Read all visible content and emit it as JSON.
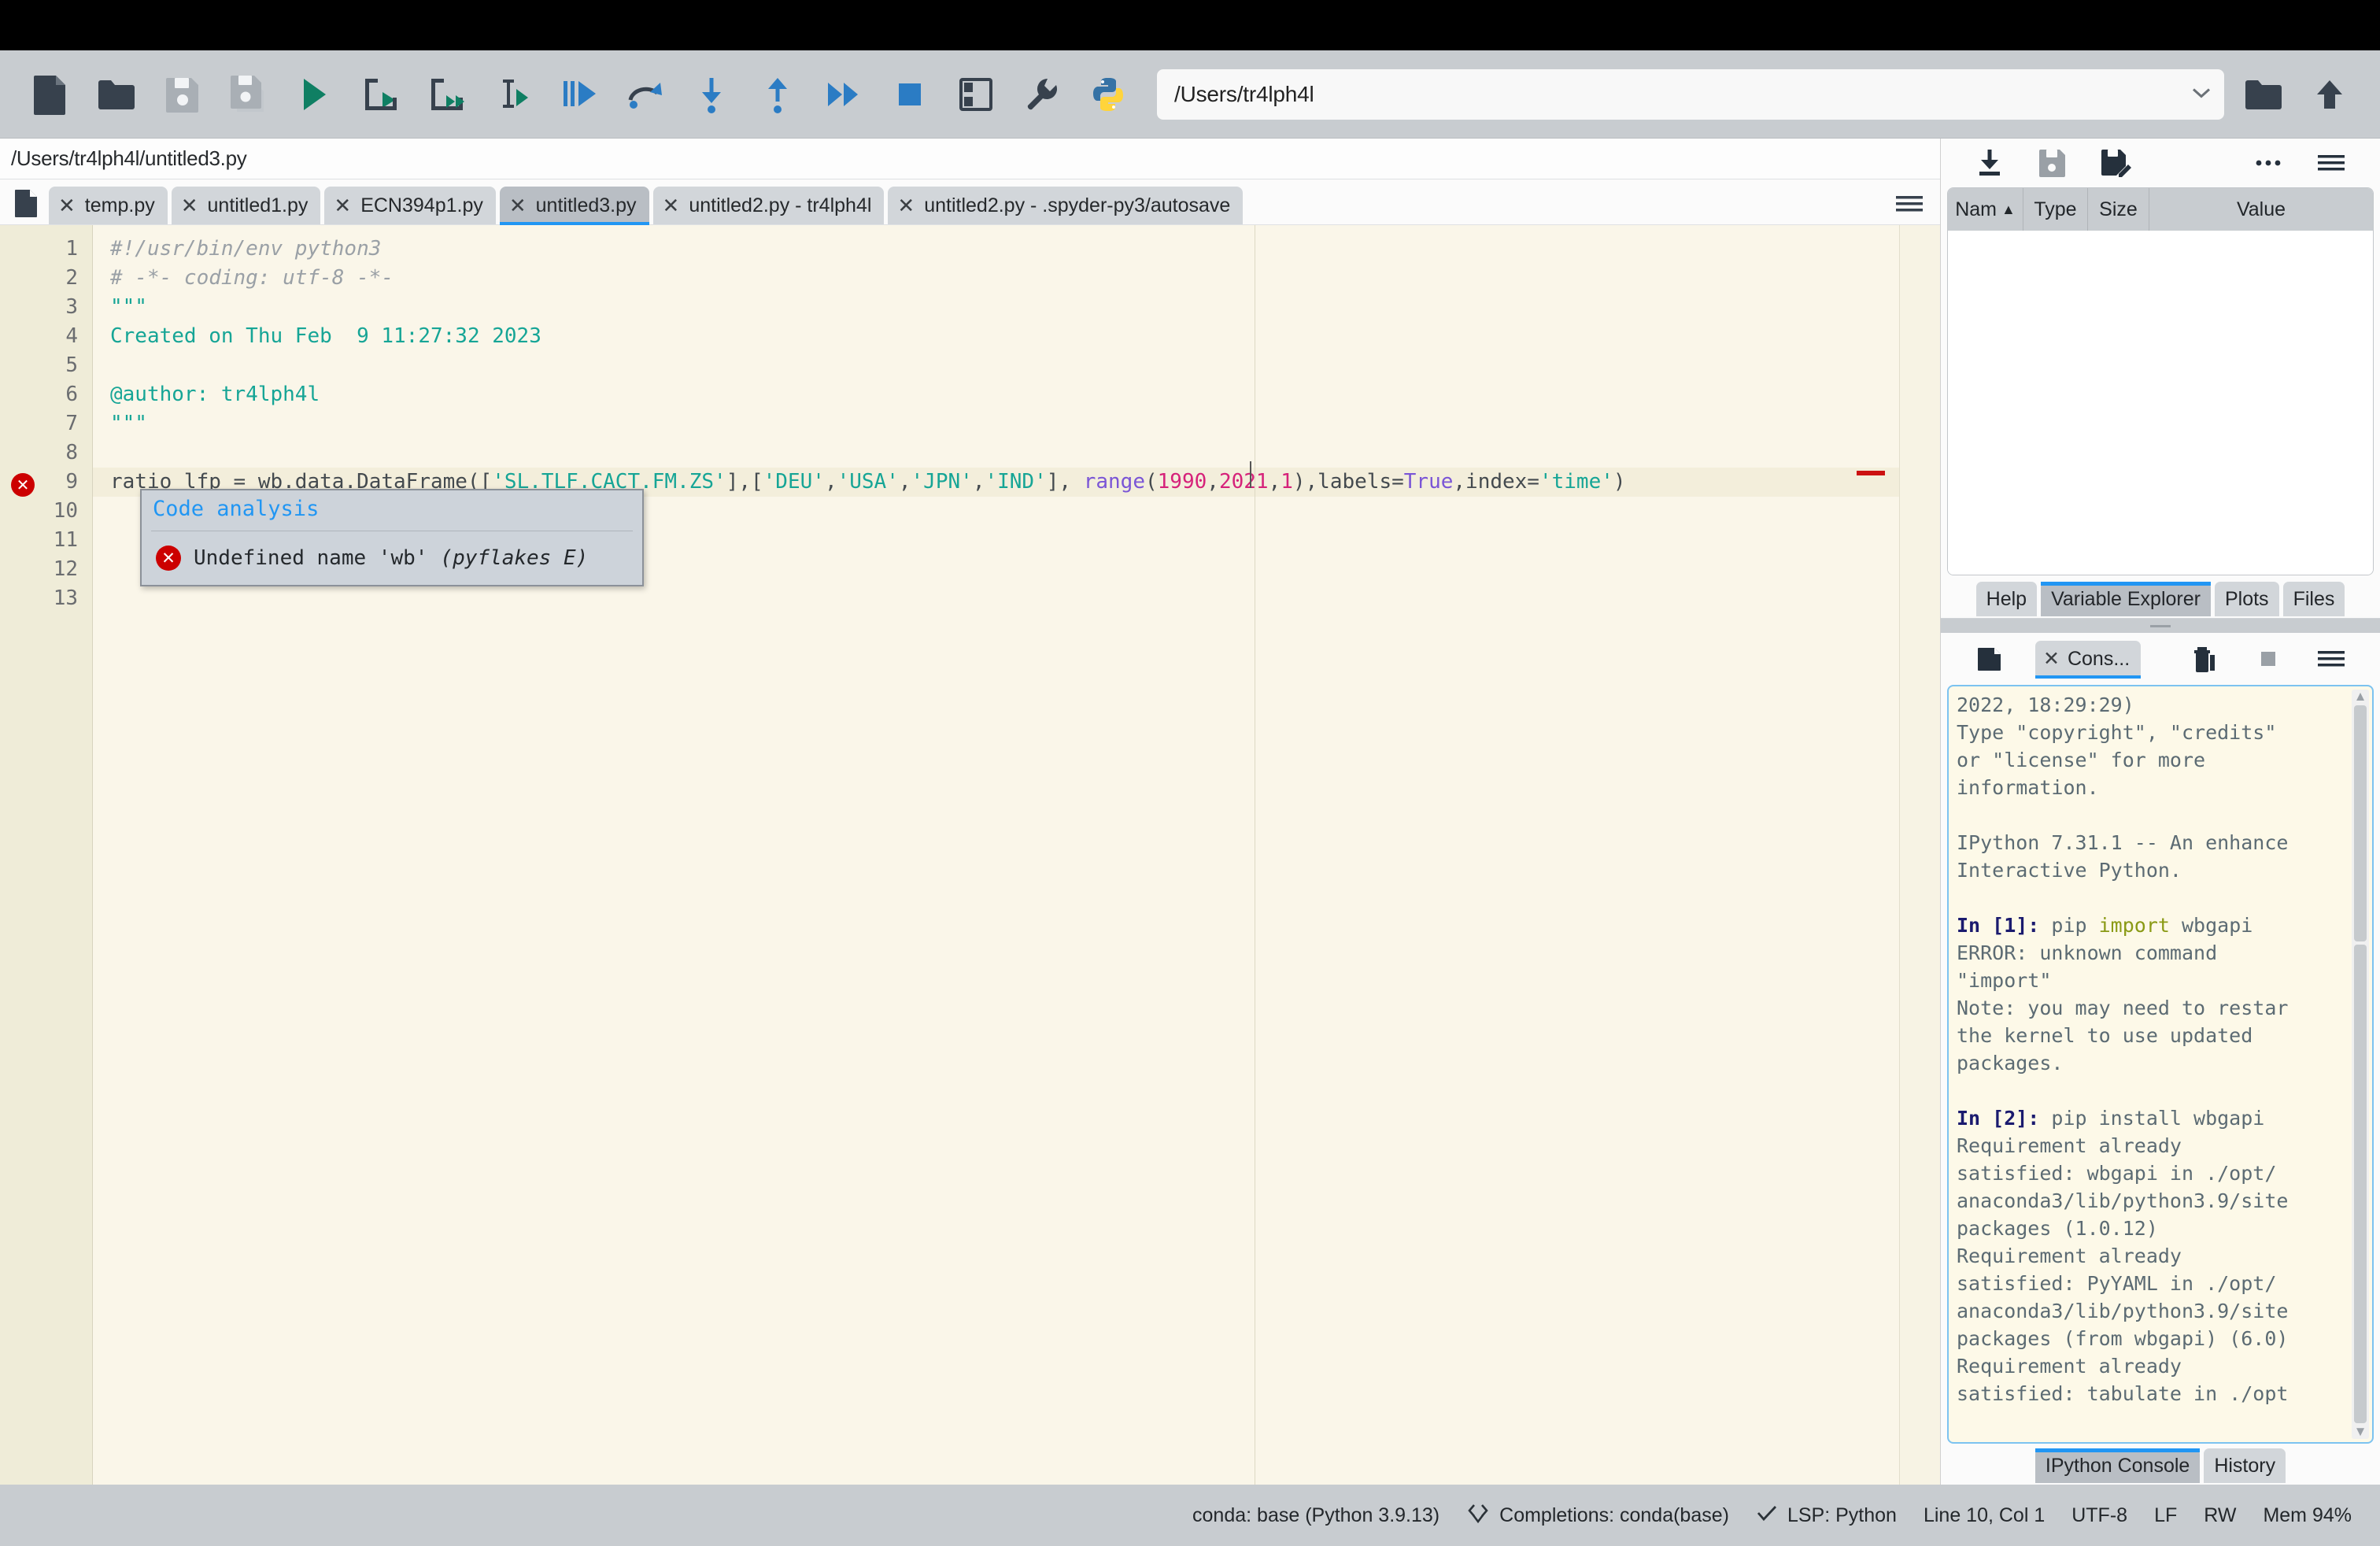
{
  "window": {
    "path_field_value": "/Users/tr4lph4l"
  },
  "toolbar": {
    "buttons": [
      {
        "name": "new-file-icon",
        "label": "New file"
      },
      {
        "name": "open-file-icon",
        "label": "Open file"
      },
      {
        "name": "save-file-icon",
        "label": "Save file"
      },
      {
        "name": "save-all-icon",
        "label": "Save all"
      },
      {
        "name": "run-file-icon",
        "label": "Run file"
      },
      {
        "name": "run-cell-icon",
        "label": "Run current cell"
      },
      {
        "name": "run-cell-advance-icon",
        "label": "Run cell and advance"
      },
      {
        "name": "run-selection-icon",
        "label": "Run selection"
      },
      {
        "name": "debug-file-icon",
        "label": "Debug file"
      },
      {
        "name": "step-over-icon",
        "label": "Step over"
      },
      {
        "name": "step-into-icon",
        "label": "Step into"
      },
      {
        "name": "step-return-icon",
        "label": "Step return"
      },
      {
        "name": "continue-icon",
        "label": "Continue"
      },
      {
        "name": "stop-debug-icon",
        "label": "Stop debugging"
      },
      {
        "name": "pane-layout-icon",
        "label": "Pane layout"
      },
      {
        "name": "preferences-icon",
        "label": "Preferences"
      },
      {
        "name": "python-path-icon",
        "label": "Python interpreter"
      }
    ],
    "browse_icon": "browse-folder-icon",
    "parent_icon": "parent-directory-icon"
  },
  "editor": {
    "breadcrumb": "/Users/tr4lph4l/untitled3.py",
    "tabs": [
      {
        "label": "temp.py",
        "active": false
      },
      {
        "label": "untitled1.py",
        "active": false
      },
      {
        "label": "ECN394p1.py",
        "active": false
      },
      {
        "label": "untitled3.py",
        "active": true
      },
      {
        "label": "untitled2.py - tr4lph4l",
        "active": false
      },
      {
        "label": "untitled2.py - .spyder-py3/autosave",
        "active": false
      }
    ],
    "line_numbers": [
      "1",
      "2",
      "3",
      "4",
      "5",
      "6",
      "7",
      "8",
      "9",
      "10",
      "11",
      "12",
      "13"
    ],
    "code_lines": [
      [
        {
          "t": "#!/usr/bin/env python3",
          "c": "cmt"
        }
      ],
      [
        {
          "t": "# -*- coding: utf-8 -*-",
          "c": "cmt"
        }
      ],
      [
        {
          "t": "\"\"\"",
          "c": "str"
        }
      ],
      [
        {
          "t": "Created on Thu Feb  9 11:27:32 2023",
          "c": "str"
        }
      ],
      [
        {
          "t": "",
          "c": "str"
        }
      ],
      [
        {
          "t": "@author: tr4lph4l",
          "c": "str"
        }
      ],
      [
        {
          "t": "\"\"\"",
          "c": "str"
        }
      ],
      [
        {
          "t": "",
          "c": "pln"
        }
      ],
      [
        {
          "t": "ratio_lfp = wb.data.DataFrame([",
          "c": "pln"
        },
        {
          "t": "'SL.TLF.CACT.FM.ZS'",
          "c": "str"
        },
        {
          "t": "],[",
          "c": "pln"
        },
        {
          "t": "'DEU'",
          "c": "str"
        },
        {
          "t": ",",
          "c": "pln"
        },
        {
          "t": "'USA'",
          "c": "str"
        },
        {
          "t": ",",
          "c": "pln"
        },
        {
          "t": "'JPN'",
          "c": "str"
        },
        {
          "t": ",",
          "c": "pln"
        },
        {
          "t": "'IND'",
          "c": "str"
        },
        {
          "t": "], ",
          "c": "pln"
        },
        {
          "t": "range",
          "c": "bld"
        },
        {
          "t": "(",
          "c": "pln"
        },
        {
          "t": "1990",
          "c": "num"
        },
        {
          "t": ",",
          "c": "pln"
        },
        {
          "t": "2021",
          "c": "num"
        },
        {
          "t": ",",
          "c": "pln"
        },
        {
          "t": "1",
          "c": "num"
        },
        {
          "t": "),labels=",
          "c": "pln"
        },
        {
          "t": "True",
          "c": "bld"
        },
        {
          "t": ",index=",
          "c": "pln"
        },
        {
          "t": "'time'",
          "c": "str"
        },
        {
          "t": ")",
          "c": "pln"
        }
      ],
      [
        {
          "t": "",
          "c": "pln"
        }
      ],
      [
        {
          "t": "",
          "c": "pln"
        }
      ],
      [
        {
          "t": "",
          "c": "pln"
        }
      ],
      [
        {
          "t": "",
          "c": "pln"
        }
      ]
    ],
    "error_line": 9,
    "tooltip": {
      "title": "Code analysis",
      "message": "Undefined name 'wb'",
      "source": "(pyflakes E)"
    }
  },
  "variable_explorer": {
    "toolbar": [
      {
        "name": "import-data-icon",
        "label": "Import data"
      },
      {
        "name": "save-data-icon",
        "label": "Save data"
      },
      {
        "name": "save-data-as-icon",
        "label": "Save data as"
      },
      {
        "name": "options-dots-icon",
        "label": "More options"
      },
      {
        "name": "pane-menu-icon",
        "label": "Options menu"
      }
    ],
    "columns": [
      {
        "label": "Nam",
        "sort": "▲"
      },
      {
        "label": "Type",
        "sort": ""
      },
      {
        "label": "Size",
        "sort": ""
      },
      {
        "label": "Value",
        "sort": ""
      }
    ],
    "rows": []
  },
  "right_pane_tabs": [
    {
      "label": "Help",
      "active": false
    },
    {
      "label": "Variable Explorer",
      "active": true
    },
    {
      "label": "Plots",
      "active": false
    },
    {
      "label": "Files",
      "active": false
    }
  ],
  "console": {
    "tab_label": "Cons...",
    "toolbar": [
      {
        "name": "new-console-icon",
        "label": "New console"
      },
      {
        "name": "remove-console-icon",
        "label": "Remove all variables"
      },
      {
        "name": "interrupt-kernel-icon",
        "label": "Interrupt kernel"
      },
      {
        "name": "console-menu-icon",
        "label": "Options menu"
      }
    ],
    "lines": [
      [
        {
          "t": "2022, 18:29:29)",
          "c": "c-plain"
        }
      ],
      [
        {
          "t": "Type \"copyright\", \"credits\"",
          "c": "c-plain"
        }
      ],
      [
        {
          "t": "or \"license\" for more",
          "c": "c-plain"
        }
      ],
      [
        {
          "t": "information.",
          "c": "c-plain"
        }
      ],
      [
        {
          "t": "",
          "c": "c-plain"
        }
      ],
      [
        {
          "t": "IPython 7.31.1 -- An enhance",
          "c": "c-plain"
        }
      ],
      [
        {
          "t": "Interactive Python.",
          "c": "c-plain"
        }
      ],
      [
        {
          "t": "",
          "c": "c-plain"
        }
      ],
      [
        {
          "t": "In [1]:",
          "c": "c-in"
        },
        {
          "t": " pip ",
          "c": "c-plain"
        },
        {
          "t": "import",
          "c": "c-kw"
        },
        {
          "t": " wbgapi",
          "c": "c-plain"
        }
      ],
      [
        {
          "t": "ERROR: unknown command",
          "c": "c-plain"
        }
      ],
      [
        {
          "t": "\"import\"",
          "c": "c-plain"
        }
      ],
      [
        {
          "t": "Note: you may need to restar",
          "c": "c-plain"
        }
      ],
      [
        {
          "t": "the kernel to use updated",
          "c": "c-plain"
        }
      ],
      [
        {
          "t": "packages.",
          "c": "c-plain"
        }
      ],
      [
        {
          "t": "",
          "c": "c-plain"
        }
      ],
      [
        {
          "t": "In [2]:",
          "c": "c-in"
        },
        {
          "t": " pip install wbgapi",
          "c": "c-plain"
        }
      ],
      [
        {
          "t": "Requirement already",
          "c": "c-plain"
        }
      ],
      [
        {
          "t": "satisfied: wbgapi in ./opt/",
          "c": "c-plain"
        }
      ],
      [
        {
          "t": "anaconda3/lib/python3.9/site",
          "c": "c-plain"
        }
      ],
      [
        {
          "t": "packages (1.0.12)",
          "c": "c-plain"
        }
      ],
      [
        {
          "t": "Requirement already",
          "c": "c-plain"
        }
      ],
      [
        {
          "t": "satisfied: PyYAML in ./opt/",
          "c": "c-plain"
        }
      ],
      [
        {
          "t": "anaconda3/lib/python3.9/site",
          "c": "c-plain"
        }
      ],
      [
        {
          "t": "packages (from wbgapi) (6.0)",
          "c": "c-plain"
        }
      ],
      [
        {
          "t": "Requirement already",
          "c": "c-plain"
        }
      ],
      [
        {
          "t": "satisfied: tabulate in ./opt",
          "c": "c-plain"
        }
      ]
    ],
    "tabs": [
      {
        "label": "IPython Console",
        "active": true
      },
      {
        "label": "History",
        "active": false
      }
    ]
  },
  "statusbar": {
    "interpreter": "conda: base (Python 3.9.13)",
    "completions": "Completions: conda(base)",
    "lsp": "LSP: Python",
    "cursor": "Line 10, Col 1",
    "encoding": "UTF-8",
    "eol": "LF",
    "permission": "RW",
    "memory": "Mem 94%"
  }
}
